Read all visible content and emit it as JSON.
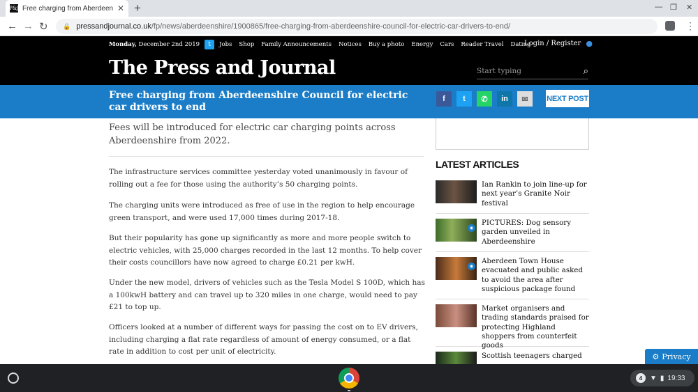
{
  "browser": {
    "tab_title": "Free charging from Aberdeenshire",
    "favicon_text": "P&J",
    "new_tab": "+",
    "url_host": "pressandjournal.co.uk",
    "url_path": "/fp/news/aberdeenshire/1900865/free-charging-from-aberdeenshire-council-for-electric-car-drivers-to-end/"
  },
  "site": {
    "date_day": "Monday,",
    "date_rest": " December 2nd 2019",
    "nav": [
      "Jobs",
      "Shop",
      "Family Announcements",
      "Notices",
      "Buy a photo",
      "Energy",
      "Cars",
      "Reader Travel",
      "Dating"
    ],
    "login": "Login / Register",
    "masthead": "The Press and Journal",
    "search_placeholder": "Start typing"
  },
  "article": {
    "headline": "Free charging from Aberdeenshire Council for electric car drivers to end",
    "next_post": "NEXT POST",
    "standfirst": "Fees will be introduced for electric car charging points across Aberdeenshire from 2022.",
    "paragraphs": [
      "The infrastructure services committee yesterday voted unanimously in favour of rolling out a fee for those using the authority’s 50 charging points.",
      "The charging units were introduced as free of use in the region to help encourage green transport, and were used 17,000 times during 2017-18.",
      "But their popularity has gone up significantly as more and more people switch to electric vehicles, with 25,000 charges recorded in the last 12 months. To help cover their costs councillors have now agreed to charge £0.21 per kwH.",
      "Under the new model, drivers of vehicles such as the Tesla Model S 100D, which has a 100kwH battery and can travel up to 320 miles in one charge, would need to pay £21 to top up.",
      "Officers looked at a number of different ways for passing the cost on to EV drivers, including charging a flat rate regardless of amount of energy consumed, or a flat rate in addition to cost per unit of electricity."
    ]
  },
  "sidebar": {
    "latest_title": "LATEST ARTICLES",
    "articles": [
      {
        "title": "Ian Rankin to join line-up for next year’s Granite Noir festival"
      },
      {
        "title": "PICTURES: Dog sensory garden unveiled in Aberdeenshire"
      },
      {
        "title": "Aberdeen Town House evacuated and public asked to avoid the area after suspicious package found"
      },
      {
        "title": "Market organisers and trading standards praised for protecting Highland shoppers from counterfeit goods"
      },
      {
        "title": "Scottish teenagers charged"
      }
    ]
  },
  "privacy": "Privacy",
  "shelf": {
    "notification_count": "4",
    "time": "19:33"
  }
}
